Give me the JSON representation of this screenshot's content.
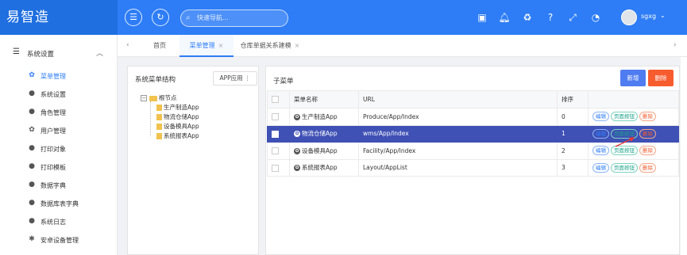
{
  "app": {
    "logo": "易智造"
  },
  "topbar": {
    "search_placeholder": "快速导航...",
    "user_name": "sgxg",
    "icons": [
      "menu-icon",
      "refresh-icon",
      "search-icon",
      "layout-icon",
      "bell-icon",
      "recycle-icon",
      "help-icon",
      "fullscreen-icon",
      "dashboard-icon",
      "caret-down-icon"
    ]
  },
  "sidebar": {
    "group_label": "系统设置",
    "items": [
      {
        "label": "菜单管理",
        "icon": "gear-icon",
        "active": true
      },
      {
        "label": "系统设置",
        "icon": "dot-icon"
      },
      {
        "label": "角色管理",
        "icon": "dot-icon"
      },
      {
        "label": "用户管理",
        "icon": "gear-icon"
      },
      {
        "label": "打印对象",
        "icon": "dot-icon"
      },
      {
        "label": "打印模板",
        "icon": "dot-icon"
      },
      {
        "label": "数据字典",
        "icon": "dot-icon"
      },
      {
        "label": "数据库表字典",
        "icon": "dot-icon"
      },
      {
        "label": "系统日志",
        "icon": "dot-icon"
      },
      {
        "label": "安卓设备管理",
        "icon": "android-icon"
      }
    ]
  },
  "tabs": [
    {
      "label": "首页"
    },
    {
      "label": "菜单管理",
      "active": true
    },
    {
      "label": "仓库单据关系建模"
    }
  ],
  "tree_panel": {
    "title": "系统菜单结构",
    "app_button": "APP应用 ⋮",
    "root": "根节点",
    "nodes": [
      "生产制造App",
      "物流仓储App",
      "设备模具App",
      "系统报表App"
    ]
  },
  "submenu": {
    "title": "子菜单",
    "add_label": "新增",
    "delete_label": "删除",
    "columns": [
      "菜单名称",
      "URL",
      "排序"
    ],
    "rows": [
      {
        "name": "生产制造App",
        "url": "Produce/App/Index",
        "order": "0"
      },
      {
        "name": "物流仓储App",
        "url": "wms/App/Index",
        "order": "1",
        "selected": true
      },
      {
        "name": "设备模具App",
        "url": "Facility/App/Index",
        "order": "2"
      },
      {
        "name": "系统报表App",
        "url": "Layout/AppList",
        "order": "3"
      }
    ],
    "row_actions": {
      "edit": "编辑",
      "page_buttons": "页面按钮",
      "delete": "删除"
    }
  },
  "colors": {
    "primary": "#2e7df6",
    "selected_row": "#3f51b5",
    "delete": "#f75c2f",
    "add": "#4f7cf0"
  }
}
